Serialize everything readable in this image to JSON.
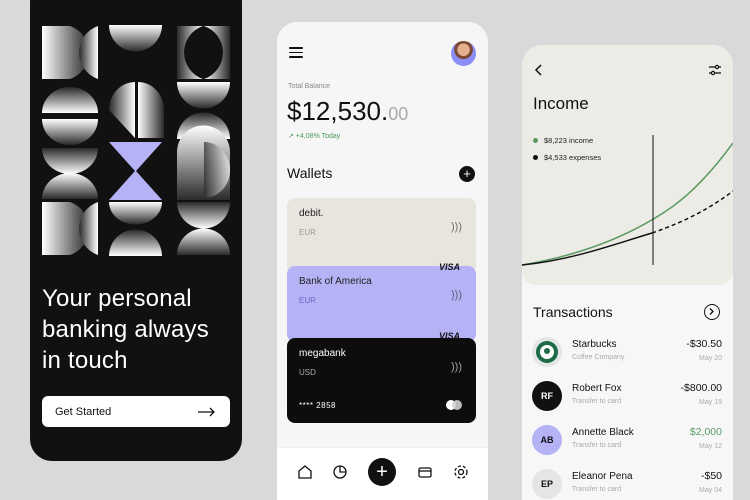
{
  "onboarding": {
    "headline_line1": "Your personal",
    "headline_line2": "banking always",
    "headline_line3": "in touch",
    "cta_label": "Get Started",
    "colors": {
      "background": "#111111",
      "accent": "#b6b2f6"
    }
  },
  "wallet_app": {
    "balance_label": "Total Balance",
    "balance_main": "$12,530.",
    "balance_cents": "00",
    "change_text": "↗ +4,08% Today",
    "wallets_title": "Wallets",
    "cards": [
      {
        "name": "debit.",
        "currency": "EUR",
        "brand": ""
      },
      {
        "name": "Bank of America",
        "currency": "EUR",
        "brand": "VISA"
      },
      {
        "name": "megabank",
        "currency": "USD",
        "brand": "VISA",
        "number": "**** 2858"
      }
    ],
    "nav": [
      "home-icon",
      "pie-chart-icon",
      "plus-icon",
      "card-icon",
      "settings-icon"
    ]
  },
  "income_app": {
    "title": "Income",
    "legend": [
      {
        "label": "$8,223 income",
        "color": "#5a9a63"
      },
      {
        "label": "$4,533 expenses",
        "color": "#111111"
      }
    ],
    "transactions_title": "Transactions",
    "transactions": [
      {
        "initials": "",
        "name": "Starbucks",
        "sub": "Coffee Company",
        "amount": "-$30.50",
        "date": "May 20",
        "amount_color": "#111111",
        "avatar_bg": "#e5e5e5"
      },
      {
        "initials": "RF",
        "name": "Robert Fox",
        "sub": "Transfer to card",
        "amount": "-$800.00",
        "date": "May 19",
        "amount_color": "#111111",
        "avatar_bg": "#111111"
      },
      {
        "initials": "AB",
        "name": "Annette Black",
        "sub": "Transfer to card",
        "amount": "$2,000",
        "date": "May 12",
        "amount_color": "#5a9a63",
        "avatar_bg": "#b6b2f6"
      },
      {
        "initials": "EP",
        "name": "Eleanor Pena",
        "sub": "Transfer to card",
        "amount": "-$50",
        "date": "May 04",
        "amount_color": "#111111",
        "avatar_bg": "#e5e5e5"
      }
    ]
  }
}
